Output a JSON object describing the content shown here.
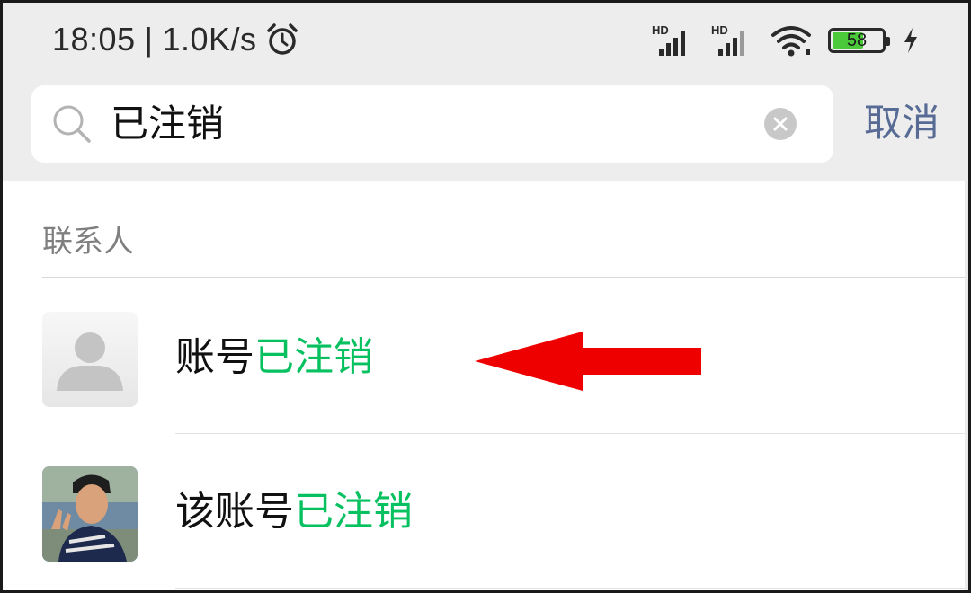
{
  "status_bar": {
    "time": "18:05",
    "separator": "|",
    "network_speed": "1.0K/s",
    "signal_label": "HD",
    "battery_level": "58",
    "icons": [
      "alarm-icon",
      "signal-icon",
      "signal-icon",
      "wifi-icon",
      "battery-icon",
      "charging-bolt-icon"
    ]
  },
  "search": {
    "query": "已注销",
    "placeholder": "",
    "cancel_label": "取消"
  },
  "results": {
    "section_title": "联系人",
    "items": [
      {
        "prefix": "账号",
        "highlight": "已注销",
        "avatar": "default-avatar"
      },
      {
        "prefix": "该账号",
        "highlight": "已注销",
        "avatar": "photo-avatar"
      }
    ]
  },
  "colors": {
    "highlight": "#07c160",
    "cancel": "#576b95",
    "header_bg": "#ededed",
    "arrow": "#ee0000"
  }
}
